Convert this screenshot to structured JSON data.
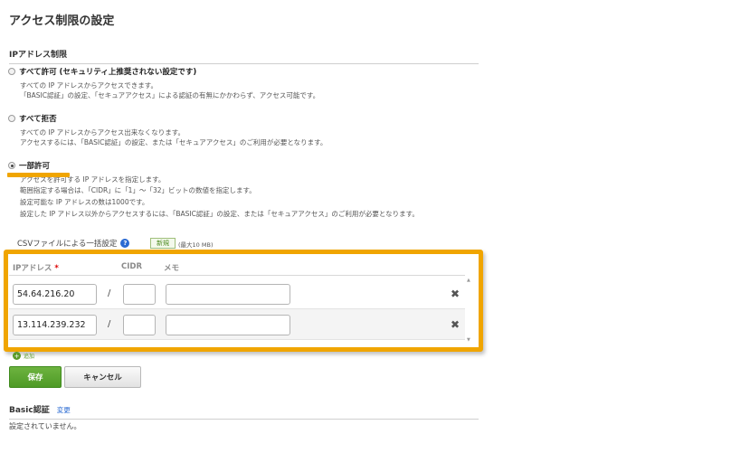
{
  "page": {
    "title": "アクセス制限の設定"
  },
  "ip_restriction": {
    "section_title": "IPアドレス制限",
    "options": [
      {
        "label": "すべて許可 (セキュリティ上推奨されない設定です)",
        "checked": false,
        "desc": [
          "すべての IP アドレスからアクセスできます。",
          "「BASIC認証」の設定、「セキュアアクセス」による認証の有無にかかわらず、アクセス可能です。"
        ]
      },
      {
        "label": "すべて拒否",
        "checked": false,
        "desc": [
          "すべての IP アドレスからアクセス出来なくなります。",
          "アクセスするには、「BASIC認証」の設定、または「セキュアアクセス」のご利用が必要となります。"
        ]
      },
      {
        "label": "一部許可",
        "checked": true,
        "desc": [
          "アクセスを許可する IP アドレスを指定します。",
          "範囲指定する場合は、「CIDR」に「1」～「32」ビットの数値を指定します。",
          "設定可能な IP アドレスの数は1000です。",
          "設定した IP アドレス以外からアクセスするには、「BASIC認証」の設定、または「セキュアアクセス」のご利用が必要となります。"
        ]
      }
    ]
  },
  "csv": {
    "label": "CSVファイルによる一括設定",
    "new_button": "新規",
    "max_size": "(最大10 MB)"
  },
  "table": {
    "headers": {
      "ip": "IPアドレス",
      "required_mark": "*",
      "cidr": "CIDR",
      "memo": "メモ"
    },
    "separator": "/",
    "rows": [
      {
        "ip": "54.64.216.20",
        "cidr": "",
        "memo": ""
      },
      {
        "ip": "13.114.239.232",
        "cidr": "",
        "memo": ""
      }
    ],
    "delete_icon": "✖"
  },
  "add_label": "追加",
  "buttons": {
    "save": "保存",
    "cancel": "キャンセル"
  },
  "basic_auth": {
    "title": "Basic認証",
    "change_link": "変更",
    "status": "設定されていません。"
  },
  "colors": {
    "accent_highlight": "#f0a500",
    "primary_button": "#5aa52e",
    "link": "#2a6ad2"
  }
}
